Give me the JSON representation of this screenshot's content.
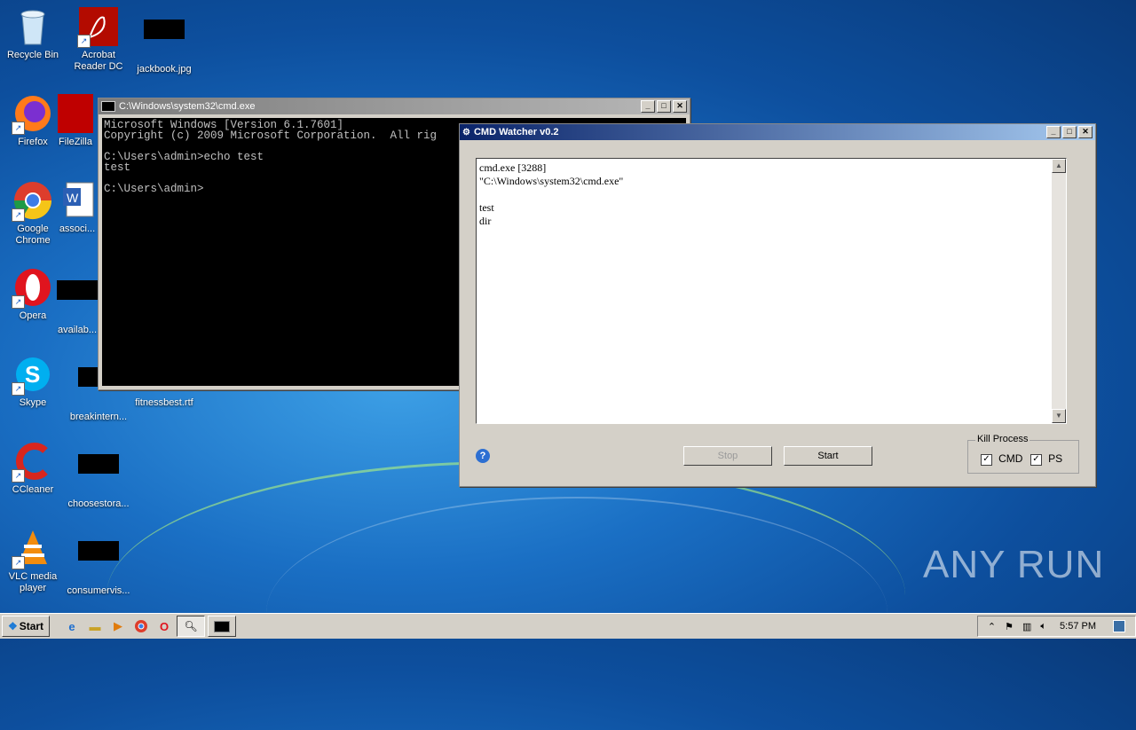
{
  "desktop_icons": [
    {
      "label": "Recycle Bin",
      "icon": "recycle-bin-icon"
    },
    {
      "label": "Acrobat Reader DC",
      "icon": "acrobat-icon"
    },
    {
      "label": "jackbook.jpg",
      "icon": "image-file-icon"
    },
    {
      "label": "Firefox",
      "icon": "firefox-icon"
    },
    {
      "label": "FileZilla",
      "icon": "filezilla-icon"
    },
    {
      "label": "Google Chrome",
      "icon": "chrome-icon"
    },
    {
      "label": "associ...",
      "icon": "word-doc-icon"
    },
    {
      "label": "Opera",
      "icon": "opera-icon"
    },
    {
      "label": "availab...",
      "icon": "file-icon"
    },
    {
      "label": "Skype",
      "icon": "skype-icon"
    },
    {
      "label": "breakintern...",
      "icon": "file-icon"
    },
    {
      "label": "fitnessbest.rtf",
      "icon": "rtf-icon"
    },
    {
      "label": "CCleaner",
      "icon": "ccleaner-icon"
    },
    {
      "label": "choosestora...",
      "icon": "file-icon"
    },
    {
      "label": "VLC media player",
      "icon": "vlc-icon"
    },
    {
      "label": "consumervis...",
      "icon": "file-icon"
    }
  ],
  "cmd_window": {
    "title": "C:\\Windows\\system32\\cmd.exe",
    "lines": "Microsoft Windows [Version 6.1.7601]\nCopyright (c) 2009 Microsoft Corporation.  All rig\n\nC:\\Users\\admin>echo test\ntest\n\nC:\\Users\\admin>"
  },
  "watcher_window": {
    "title": "CMD Watcher v0.2",
    "log_text": "cmd.exe [3288]\n\"C:\\Windows\\system32\\cmd.exe\"\n\ntest\ndir\n",
    "stop_label": "Stop",
    "start_label": "Start",
    "kill_group_label": "Kill Process",
    "cmd_label": "CMD",
    "ps_label": "PS",
    "cmd_checked": true,
    "ps_checked": true
  },
  "taskbar": {
    "start_label": "Start",
    "clock": "5:57 PM"
  },
  "watermark": "ANY RUN"
}
